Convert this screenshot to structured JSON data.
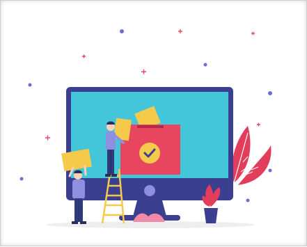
{
  "scene": {
    "subject": "online-voting-illustration",
    "icons": [
      "monitor-icon",
      "ballot-box-icon",
      "checkmark-icon",
      "ballot-paper-icon",
      "ladder-icon",
      "plant-icon",
      "leaf-icon",
      "person-icon"
    ],
    "colors": {
      "background": "#ffffff",
      "monitor_frame": "#3b3f8f",
      "screen": "#43c6d9",
      "ballot_box": "#e8465f",
      "ballot_paper": "#f5c94a",
      "check_circle": "#f5c94a",
      "check_mark": "#3b3f8f",
      "stand": "#3b3f8f",
      "stand_slot": "#8e8fe0",
      "ground": "#eeeeee",
      "plant": "#e23e5c",
      "pot": "#3b3f8f",
      "ladder": "#f5c94a",
      "person_shirt": "#8e8fe0",
      "person_pants": "#2f3a7a",
      "person_skin": "#ffd2b8",
      "person_hair": "#2c2e5a",
      "sparkle_plus": "#e8465f",
      "sparkle_dot": "#6a6fd0",
      "decor_wave": "#f08aa8"
    }
  }
}
